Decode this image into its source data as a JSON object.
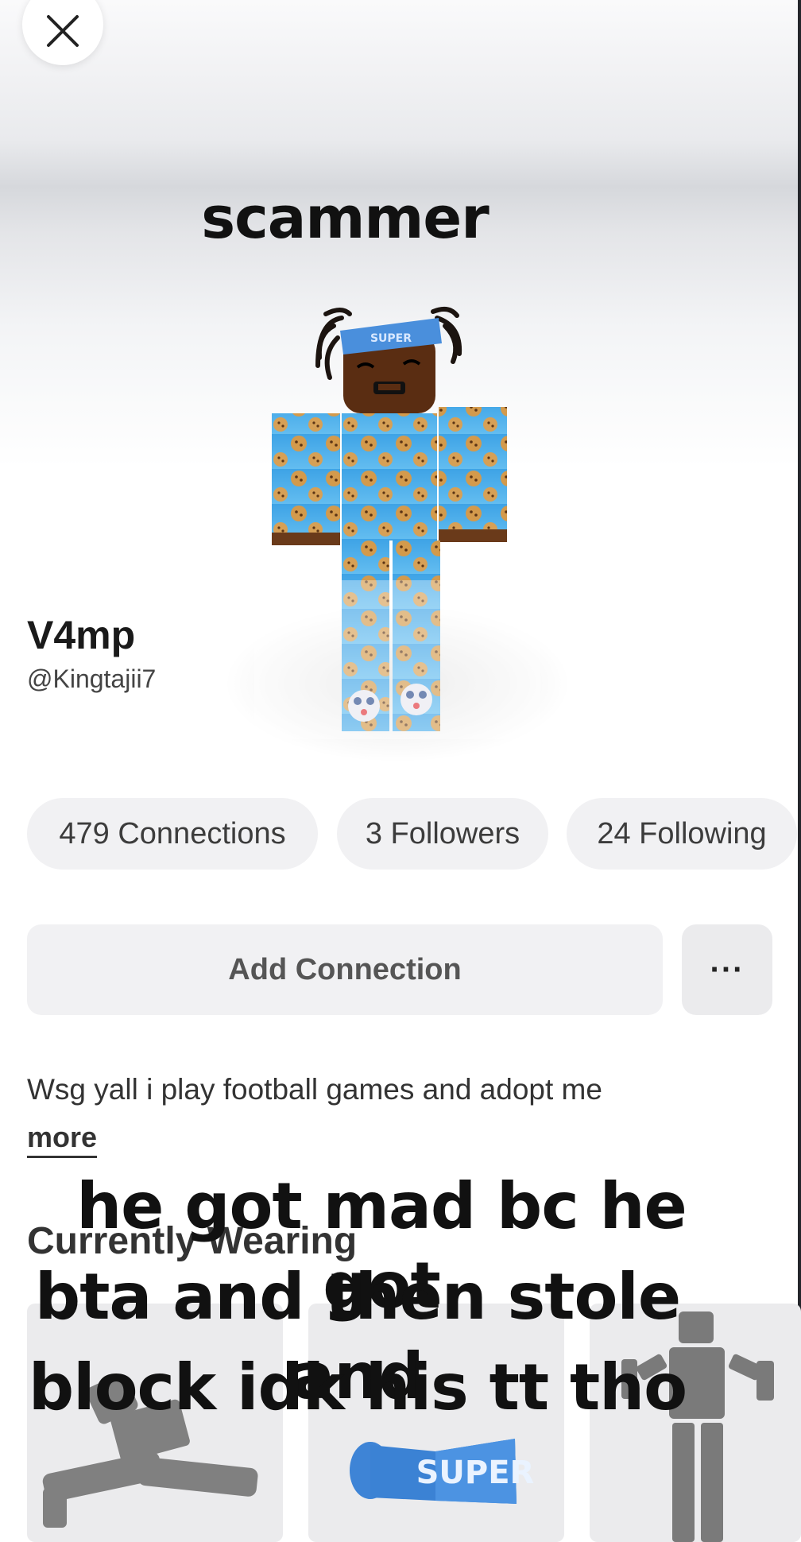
{
  "close_button": {
    "icon": "close-icon"
  },
  "overlay_caption_top": "scammer",
  "profile": {
    "display_name": "V4mp",
    "username": "@Kingtajii7",
    "avatar": {
      "icon": "avatar-character",
      "headband_text": "SUPER"
    }
  },
  "stats": {
    "connections": "479 Connections",
    "followers": "3 Followers",
    "following": "24 Following"
  },
  "actions": {
    "add_connection": "Add Connection",
    "more": "···"
  },
  "bio": {
    "text": "Wsg yall i play football games and adopt me",
    "more_link": "more"
  },
  "currently_wearing": {
    "title": "Currently Wearing",
    "items": [
      {
        "icon": "split-emote-figure"
      },
      {
        "icon": "super-headband",
        "label": "SUPER"
      },
      {
        "icon": "avatar-pose-figure"
      }
    ]
  },
  "overlay_caption_bottom": {
    "line1": "he got mad bc he got",
    "line2": "bta and then stole and",
    "line3": "block idk his tt tho"
  },
  "colors": {
    "pill_bg": "#f1f1f3",
    "overlay_text": "#111111",
    "shirt_blue": "#2f9be0",
    "cookie": "#d39a4c"
  }
}
